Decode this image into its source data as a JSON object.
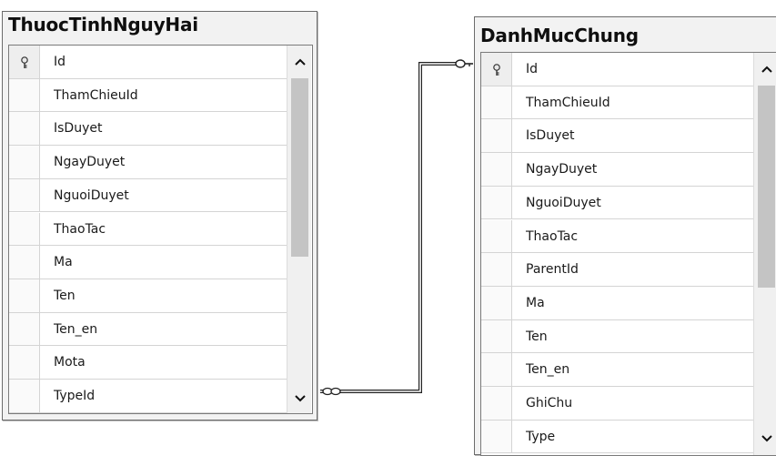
{
  "tables": [
    {
      "title": "ThuocTinhNguyHai",
      "columns": [
        "Id",
        "ThamChieuId",
        "IsDuyet",
        "NgayDuyet",
        "NguoiDuyet",
        "ThaoTac",
        "Ma",
        "Ten",
        "Ten_en",
        "Mota",
        "TypeId"
      ],
      "primary_key": "Id"
    },
    {
      "title": "DanhMucChung",
      "columns": [
        "Id",
        "ThamChieuId",
        "IsDuyet",
        "NgayDuyet",
        "NguoiDuyet",
        "ThaoTac",
        "ParentId",
        "Ma",
        "Ten",
        "Ten_en",
        "GhiChu",
        "Type"
      ],
      "primary_key": "Id"
    }
  ],
  "scroll": {
    "up_glyph": "^",
    "down_glyph": "v"
  },
  "icons": {
    "primary_key": "key-icon",
    "relationship_many_end": "infinity-icon",
    "relationship_one_end": "key-icon"
  }
}
